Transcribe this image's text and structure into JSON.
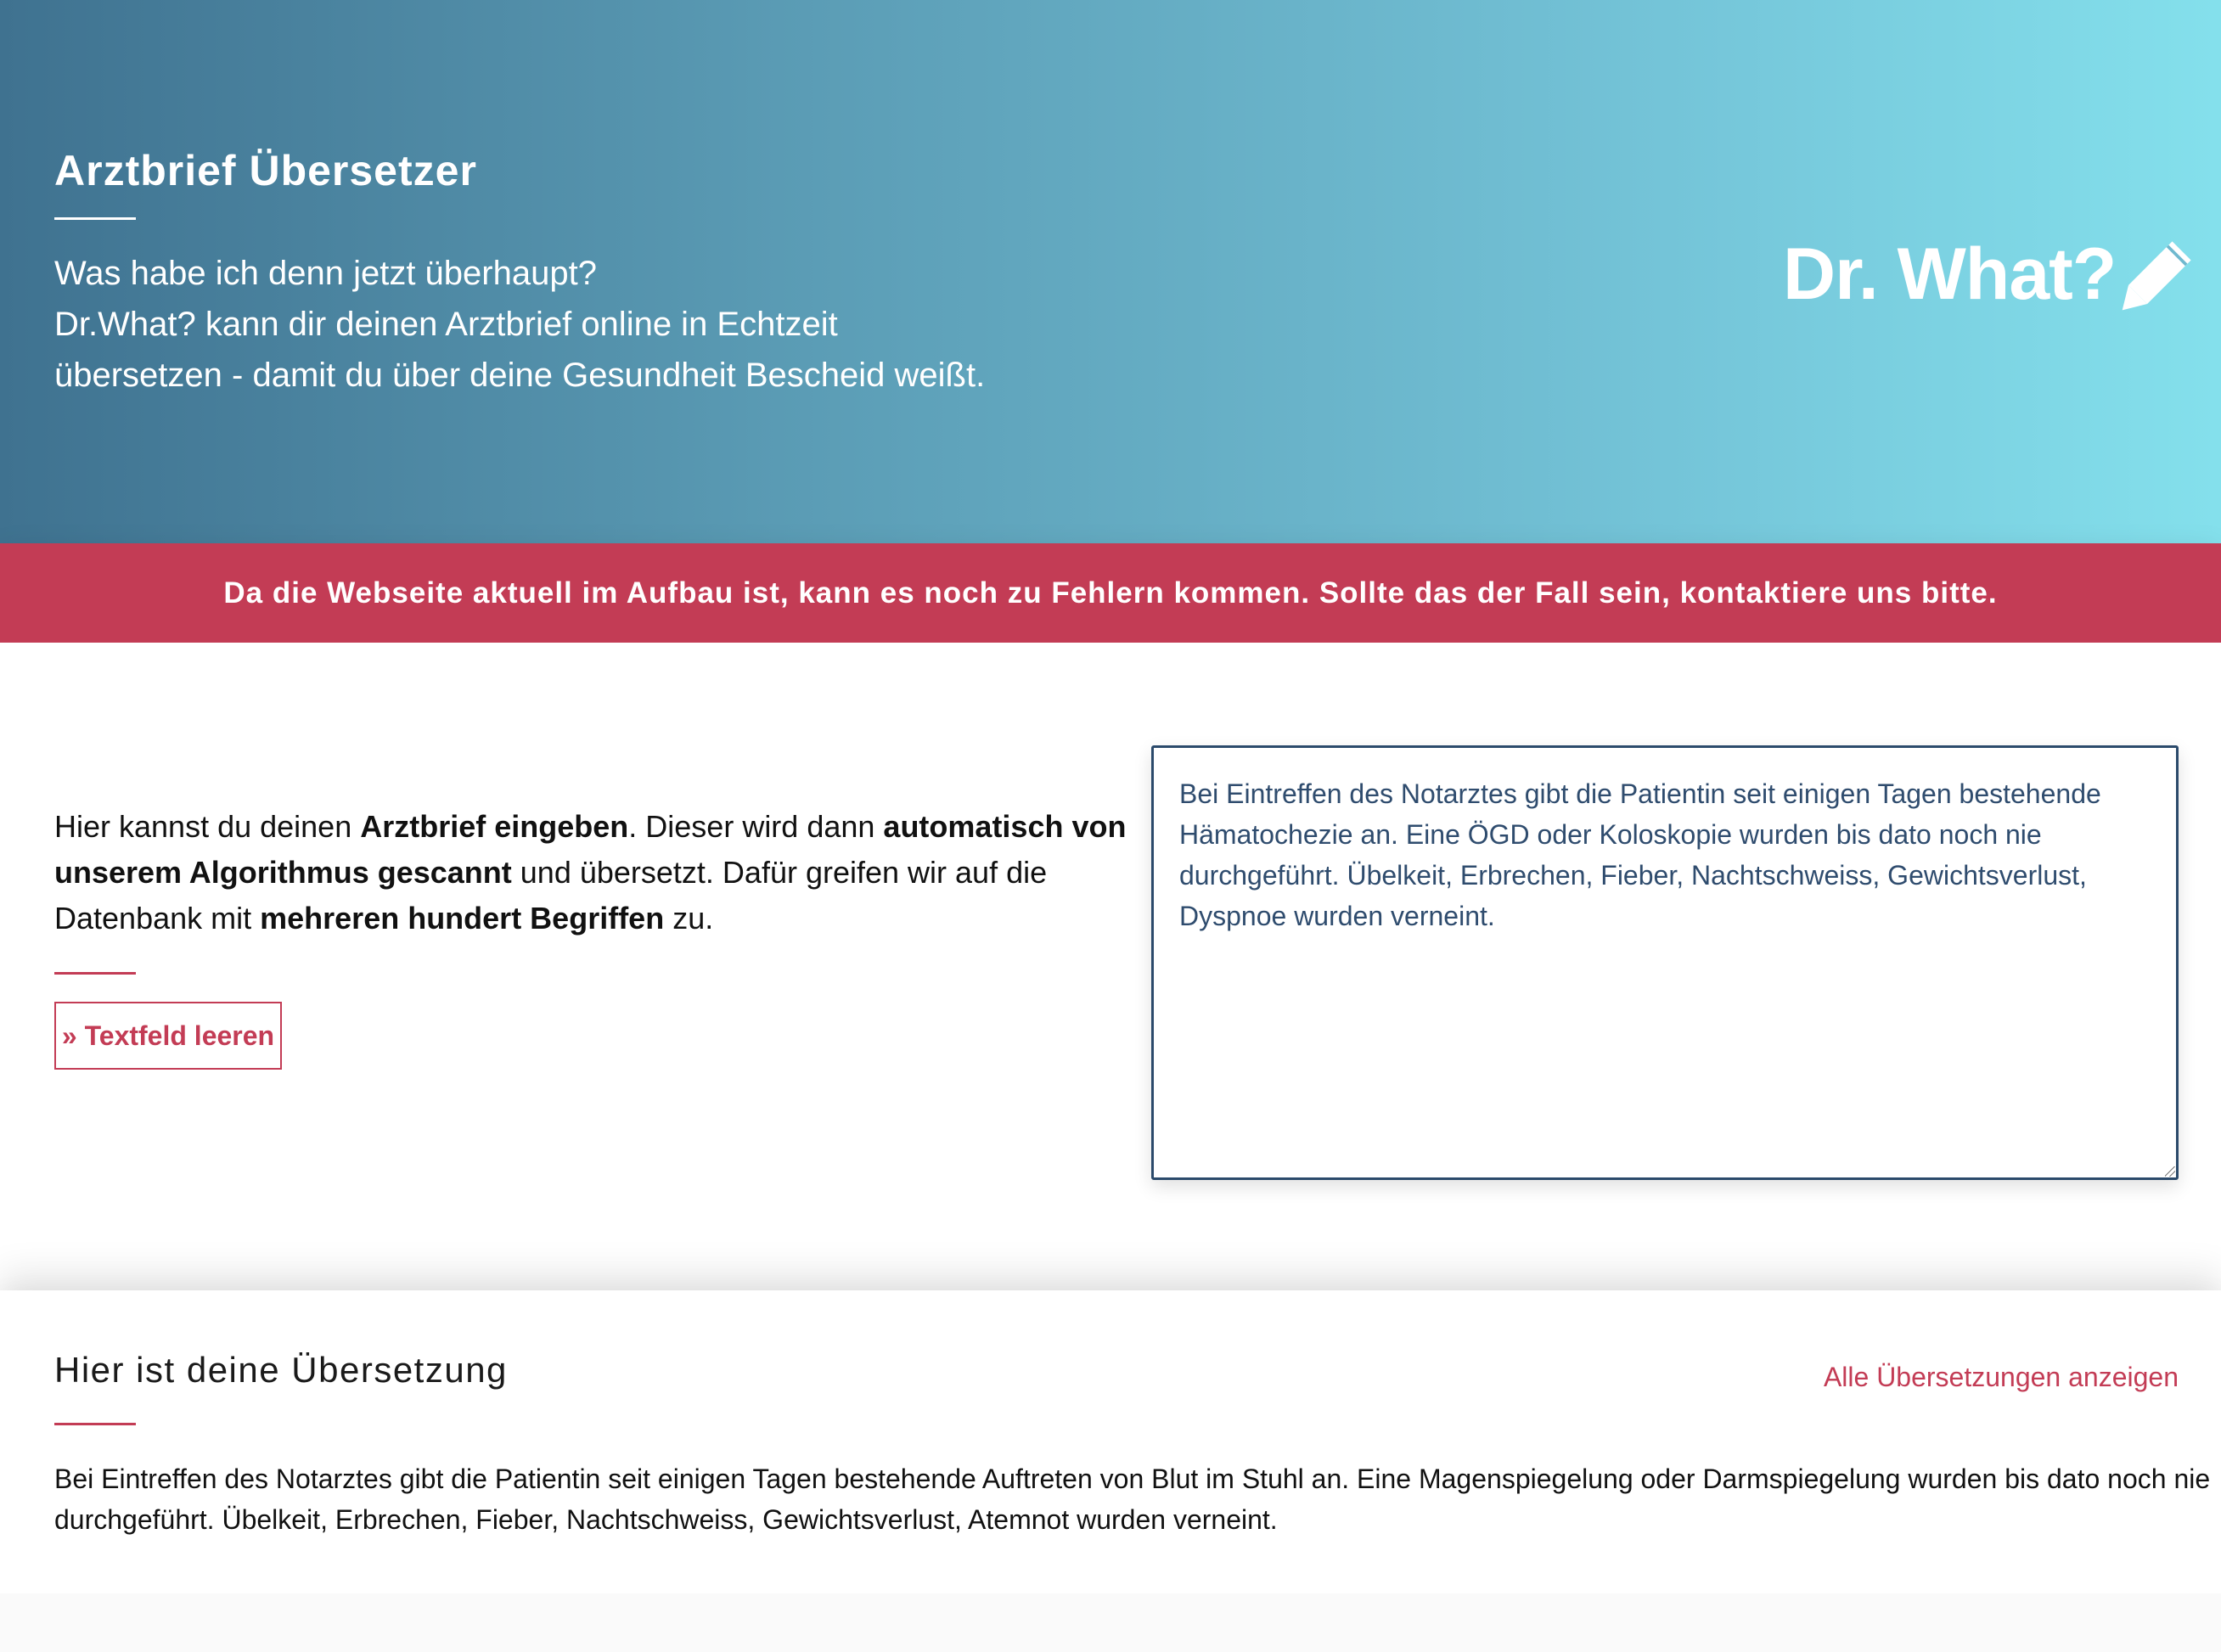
{
  "hero": {
    "title": "Arztbrief Übersetzer",
    "lines": [
      "Was habe ich denn jetzt überhaupt?",
      "Dr.What? kann dir deinen Arztbrief online in Echtzeit",
      "übersetzen - damit du über deine Gesundheit Bescheid weißt."
    ],
    "logo_text": "Dr. What?",
    "logo_icon": "pencil-icon"
  },
  "banner": {
    "text": "Da die Webseite aktuell im Aufbau ist, kann es noch zu Fehlern kommen. Sollte das der Fall sein, kontaktiere uns bitte."
  },
  "intro": {
    "l1_a": "Hier kannst du deinen ",
    "l1_b": "Arztbrief eingeben",
    "l1_c": ". Dieser wird dann ",
    "l1_d": "automatisch von",
    "l2_a": "unserem Algorithmus gescannt",
    "l2_b": " und übersetzt. Dafür greifen wir auf die",
    "l3_a": "Datenbank mit ",
    "l3_b": "mehreren hundert Begriffen",
    "l3_c": " zu."
  },
  "clear_button": {
    "label": "» Textfeld leeren"
  },
  "input": {
    "value": "Bei Eintreffen des Notarztes gibt die Patientin seit einigen Tagen bestehende Hämatochezie an. Eine ÖGD oder Koloskopie wurden bis dato noch nie durchgeführt. Übelkeit, Erbrechen, Fieber, Nachtschweiss, Gewichtsverlust, Dyspnoe wurden verneint."
  },
  "translation": {
    "title": "Hier ist deine Übersetzung",
    "all_link": "Alle Übersetzungen anzeigen",
    "line1": "Bei Eintreffen des Notarztes gibt die Patientin seit einigen Tagen bestehende Auftreten von Blut im Stuhl an. Eine Magenspiegelung oder Darmspiegelung wurden bis dato noch nie",
    "line2": "durchgeführt. Übelkeit, Erbrechen, Fieber, Nachtschweiss, Gewichtsverlust, Atemnot wurden verneint."
  },
  "colors": {
    "accent": "#c33c55",
    "hero_start": "#3f7290",
    "hero_end": "#84e0ec",
    "input_text": "#2f4c6e"
  }
}
